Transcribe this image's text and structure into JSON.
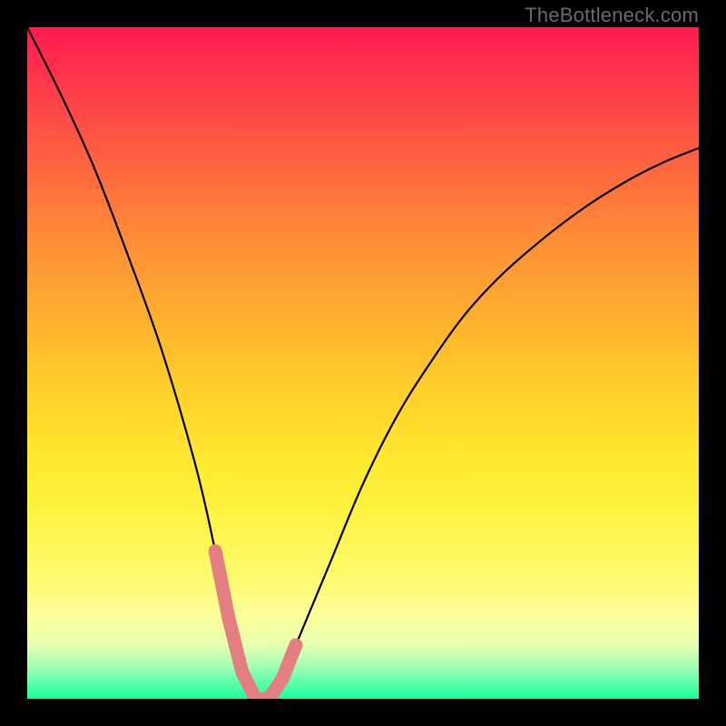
{
  "watermark": "TheBottleneck.com",
  "chart_data": {
    "type": "line",
    "title": "",
    "xlabel": "",
    "ylabel": "",
    "xlim": [
      0,
      100
    ],
    "ylim": [
      0,
      100
    ],
    "grid": false,
    "legend": false,
    "x": [
      0,
      5,
      10,
      15,
      20,
      25,
      28,
      30,
      32,
      34,
      36,
      38,
      40,
      45,
      50,
      55,
      60,
      65,
      70,
      75,
      80,
      85,
      90,
      95,
      100
    ],
    "series": [
      {
        "name": "bottleneck-curve",
        "color": "#000000",
        "values": [
          100,
          90,
          79,
          66,
          52,
          35,
          22,
          12,
          4,
          0,
          0,
          3,
          8,
          20,
          32,
          42,
          50,
          57,
          62.5,
          67,
          71,
          74.5,
          77.5,
          80,
          82
        ]
      }
    ],
    "markers": [
      {
        "name": "highlight-segment",
        "color": "#e37f83",
        "x": [
          28,
          30,
          32,
          34,
          36,
          38,
          40
        ],
        "values": [
          22,
          12,
          4,
          0,
          0,
          3,
          8
        ]
      }
    ],
    "background_gradient": {
      "top": "#ff1a52",
      "mid": "#ffe82f",
      "bottom": "#1aff9f"
    }
  }
}
